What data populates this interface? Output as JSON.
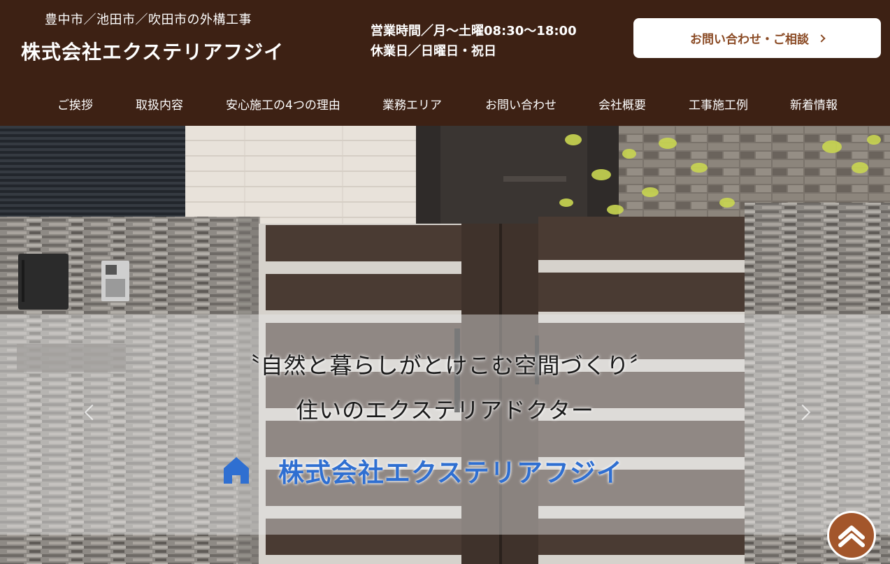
{
  "header": {
    "brand_sub": "豊中市／池田市／吹田市の外構工事",
    "brand_main": "株式会社エクステリアフジイ",
    "hours_line1": "営業時間／月〜土曜08:30〜18:00",
    "hours_line2": "休業日／日曜日・祝日",
    "cta_label": "お問い合わせ・ご相談"
  },
  "nav": {
    "items": [
      {
        "label": "ご挨拶"
      },
      {
        "label": "取扱内容"
      },
      {
        "label": "安心施工の4つの理由"
      },
      {
        "label": "業務エリア"
      },
      {
        "label": "お問い合わせ"
      },
      {
        "label": "会社概要"
      },
      {
        "label": "工事施工例"
      },
      {
        "label": "新着情報"
      }
    ]
  },
  "hero": {
    "tagline1": "〝自然と暮らしがとけこむ空間づくり〞",
    "tagline2": "住いのエクステリアドクター",
    "company": "株式会社エクステリアフジイ"
  },
  "colors": {
    "header_bg": "#3d2114",
    "cta_text": "#8a4a24",
    "hero_company": "#2f6fd1",
    "page_top_bg": "#a3562b"
  },
  "icons": {
    "cta": "chevron-right-icon",
    "hero_company": "house-icon",
    "page_top": "chevron-up-icon",
    "slider_prev": "chevron-left-icon",
    "slider_next": "chevron-right-icon"
  }
}
